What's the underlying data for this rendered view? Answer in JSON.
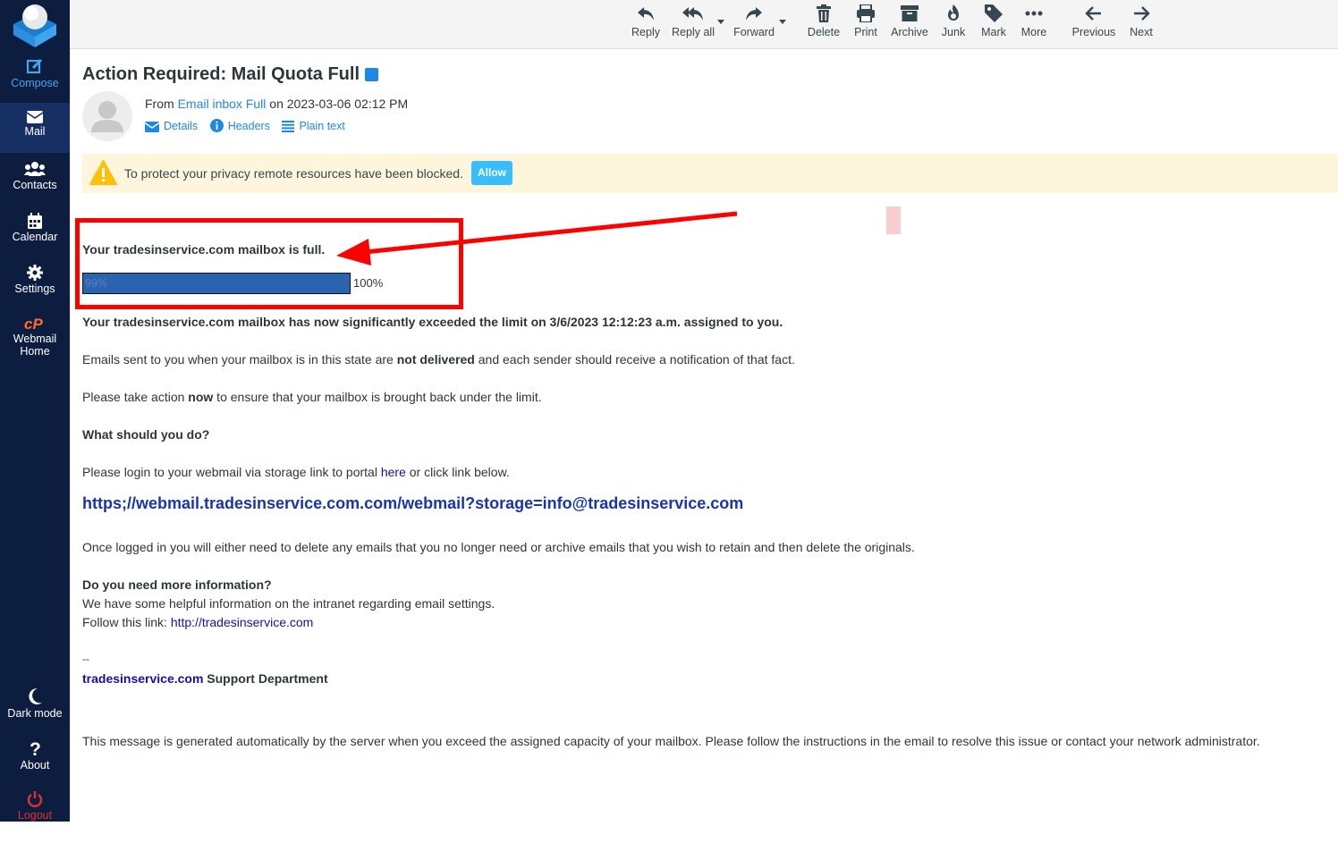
{
  "sidebar": {
    "items": [
      {
        "label": "Compose",
        "icon": "compose-icon"
      },
      {
        "label": "Mail",
        "icon": "mail-icon"
      },
      {
        "label": "Contacts",
        "icon": "contacts-icon"
      },
      {
        "label": "Calendar",
        "icon": "calendar-icon"
      },
      {
        "label": "Settings",
        "icon": "gear-icon"
      },
      {
        "label": "Webmail Home",
        "icon": "cpanel-icon"
      }
    ],
    "bottom": [
      {
        "label": "Dark mode",
        "icon": "moon-icon"
      },
      {
        "label": "About",
        "icon": "question-icon"
      },
      {
        "label": "Logout",
        "icon": "power-icon"
      }
    ]
  },
  "toolbar": {
    "reply": "Reply",
    "reply_all": "Reply all",
    "forward": "Forward",
    "delete": "Delete",
    "print": "Print",
    "archive": "Archive",
    "junk": "Junk",
    "mark": "Mark",
    "more": "More",
    "previous": "Previous",
    "next": "Next"
  },
  "message": {
    "subject": "Action Required: Mail Quota Full",
    "from_prefix": "From",
    "from_name": "Email inbox Full",
    "date_text": "on 2023-03-06 02:12 PM",
    "links": {
      "details": "Details",
      "headers": "Headers",
      "plain_text": "Plain text"
    },
    "privacy_notice": "To protect your privacy remote resources have been blocked.",
    "allow_label": "Allow"
  },
  "body": {
    "mailbox_full": "Your tradesinservice.com mailbox is full.",
    "quota_label": "99%",
    "quota_value": 0.99,
    "quota_max": "100%",
    "exceeded": "Your tradesinservice.com mailbox has now significantly exceeded the limit on 3/6/2023 12:12:23 a.m. assigned to you.",
    "not_delivered_pre": "Emails sent to you when your mailbox is in this state are ",
    "not_delivered_bold": "not delivered",
    "not_delivered_post": " and each sender should receive a notification of that fact.",
    "action_pre": "Please take action ",
    "action_bold": "now",
    "action_post": " to ensure that your mailbox is brought back under the limit.",
    "what_heading": "What should you do?",
    "login_pre": "Please login to your webmail via storage link to portal ",
    "login_link": "here",
    "login_post": " or click link below.",
    "big_link": "https;//webmail.tradesinservice.com.com/webmail?storage=info@tradesinservice.com",
    "once_logged": "Once logged in you will either need to delete any emails that you no longer need or archive emails that you wish to retain and then delete the originals.",
    "more_info_heading": "Do you need more information?",
    "helpful_info": "We have some helpful information on the intranet regarding email settings.",
    "follow_pre": "Follow this link: ",
    "follow_link": "http://tradesinservice.com",
    "sig_dash": "--",
    "sig_domain": "tradesinservice.com",
    "sig_dept": " Support Department",
    "footer": "This message is generated automatically by the server when you exceed the assigned capacity of your mailbox. Please follow the instructions in the email to resolve this issue or contact your network administrator."
  },
  "colors": {
    "sidebar_bg": "#0c1d3f",
    "accent": "#1e88e5",
    "annotation_red": "#ff0000",
    "quota_bar": "#2b63b0"
  }
}
